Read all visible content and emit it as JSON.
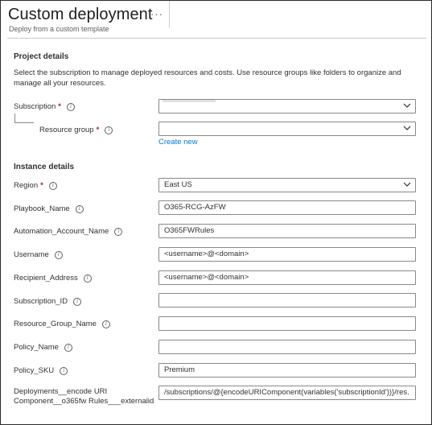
{
  "header": {
    "title": "Custom deployment",
    "more_label": "···",
    "subtitle": "Deploy from a custom template"
  },
  "project": {
    "heading": "Project details",
    "description": "Select the subscription to manage deployed resources and costs. Use resource groups like folders to organize and manage all your resources.",
    "subscription_label": "Subscription",
    "subscription_value": "",
    "resource_group_label": "Resource group",
    "resource_group_value": "",
    "create_new": "Create new",
    "required_mark": "*"
  },
  "instance": {
    "heading": "Instance details",
    "fields": [
      {
        "label": "Region",
        "value": "East US",
        "required": true,
        "dropdown": true
      },
      {
        "label": "Playbook_Name",
        "value": "O365-RCG-AzFW"
      },
      {
        "label": "Automation_Account_Name",
        "value": "O365FWRules"
      },
      {
        "label": "Username",
        "value": "<username>@<domain>"
      },
      {
        "label": "Recipient_Address",
        "value": "<username>@<domain>"
      },
      {
        "label": "Subscription_ID",
        "value": ""
      },
      {
        "label": "Resource_Group_Name",
        "value": ""
      },
      {
        "label": "Policy_Name",
        "value": ""
      },
      {
        "label": "Policy_SKU",
        "value": "Premium"
      },
      {
        "label_line1": "Deployments__encode URI",
        "label_line2": "Component__o365fw Rules___externalid",
        "value": "/subscriptions/@{encodeURIComponent(variables('subscriptionId'))}/res..."
      }
    ]
  },
  "icons": {
    "info": "info-icon",
    "dropdown": "chevron-down-icon"
  }
}
